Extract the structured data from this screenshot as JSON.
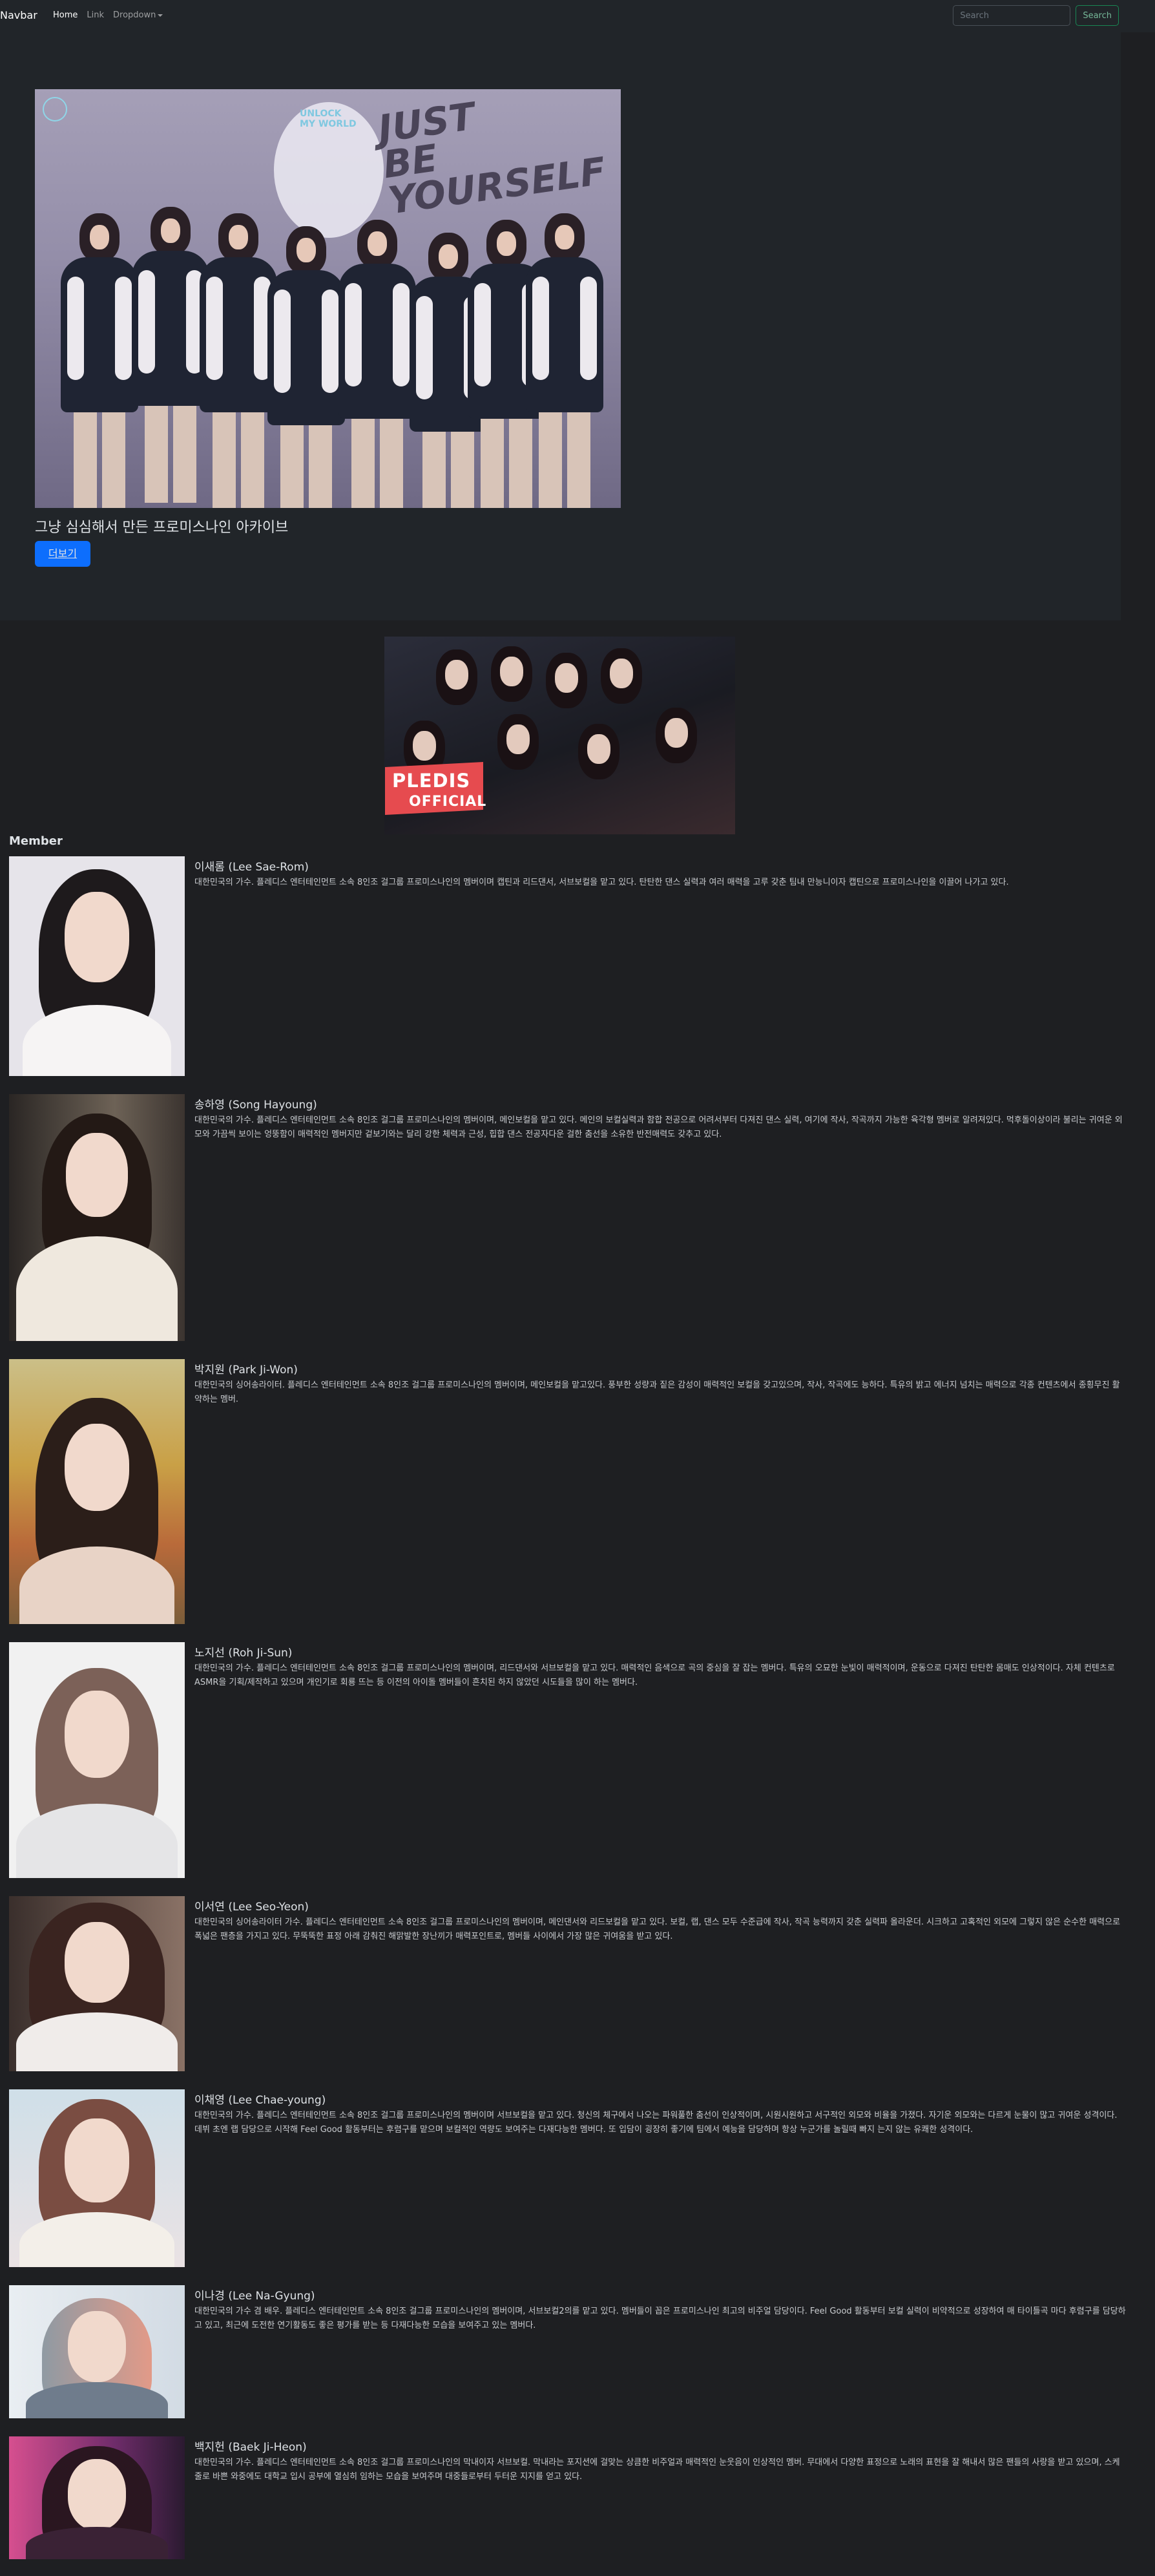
{
  "navbar": {
    "brand": "Navbar",
    "links": [
      "Home",
      "Link",
      "Dropdown"
    ],
    "search_placeholder": "Search",
    "search_button": "Search"
  },
  "hero": {
    "caption": "그냥 심심해서 만든 프로미스나인 아카이브",
    "button": "더보기"
  },
  "video": {
    "badge_title": "PLEDIS",
    "badge_subtitle": "OFFICIAL"
  },
  "members_title": "Member",
  "members": [
    {
      "name": "이새롬 (Lee Sae-Rom)",
      "desc": "대한민국의 가수. 플레디스 엔터테인먼트 소속 8인조 걸그룹 프로미스나인의 멤버이며 캡틴과 리드댄서, 서브보컬을 맡고 있다. 탄탄한 댄스 실력과 여러 매력을 고루 갖춘 팀내 만능니이자 캡틴으로 프로미스나인을 이끌어 나가고 있다."
    },
    {
      "name": "송하영 (Song Hayoung)",
      "desc": "대한민국의 가수. 플레디스 엔터테인먼트 소속 8인조 걸그룹 프로미스나인의 멤버이며, 메인보컬을 맡고 있다. 메인의 보컬실력과 함합 전공으로 어려서부터 다져진 댄스 실력, 여기에 작사, 작곡까지 가능한 육각형 멤버로 알려져있다. 먹후돌이상이라 불리는 귀여운 외모와 가끔씩 보이는 엉뚱함이 매력적인 멤버지만 겉보기와는 달리 강한 체력과 근성, 힙합 댄스 전공자다운 걸한 춤선을 소유한 반전매력도 갖추고 있다."
    },
    {
      "name": "박지원 (Park Ji-Won)",
      "desc": "대한민국의 싱어송라이터. 플레디스 엔터테인먼트 소속 8인조 걸그룹 프로미스나인의 멤버이며, 메인보컬을 맡고있다. 풍부한 성량과 짙은 감성이 매력적인 보컬을 갖고있으며, 작사, 작곡에도 능하다. 특유의 밝고 에너지 넘치는 매력으로 각종 컨텐츠에서 종횡무진 활약하는 멤버."
    },
    {
      "name": "노지선 (Roh Ji-Sun)",
      "desc": "대한민국의 가수. 플레디스 엔터테인먼트 소속 8인조 걸그룹 프로미스나인의 멤버이며, 리드댄서와 서브보컬을 맡고 있다. 매력적인 음색으로 곡의 중심을 잘 잡는 멤버다. 특유의 오묘한 눈빛이 매력적이며, 운동으로 다져진 탄탄한 몸매도 인상적이다. 자체 컨텐츠로 ASMR을 기획/제작하고 있으며 개인기로 회룡 뜨는 등 이전의 아이돌 멤버들이 흔치된 하지 않았던 시도들을 많이 하는 멤버다."
    },
    {
      "name": "이서연 (Lee Seo-Yeon)",
      "desc": "대한민국의 싱어송라이터 가수. 플레디스 엔터테인먼트 소속 8인조 걸그룹 프로미스나인의 멤버이며, 메인댄서와 리드보컬을 맡고 있다. 보컬, 랩, 댄스 모두 수준급에 작사, 작곡 능력까지 갖춘 실력파 올라운더. 시크하고 고혹적인 외모에 그렇지 않은 순수한 매력으로 폭넓은 팬층을 가지고 있다. 무뚝뚝한 표정 아래 감춰진 해맑발한 장난끼가 매력포인트로, 멤버들 사이에서 가장 많은 귀여움을 받고 있다."
    },
    {
      "name": "이채영 (Lee Chae-young)",
      "desc": "대한민국의 가수. 플레디스 엔터테인먼트 소속 8인조 걸그룹 프로미스나인의 멤버이며 서브보컬을 맡고 있다. 청신의 체구에서 나오는 파워풀한 춤선이 인상적이며, 시원시원하고 서구적인 외모와 비율을 가졌다. 자기운 외모와는 다르게 눈물이 많고 귀여운 성격이다. 데뷔 초엔 랩 담당으로 시작해 Feel Good 활동부터는 후렴구를 맡으며 보컬적인 역량도 보여주는 다재다능한 멤버다. 또 입담이 굉장히 좋기에 팀에서 예능을 담당하며 항상 누군가를 놀릴때 빠지 는지 않는 유쾌한 성격이다."
    },
    {
      "name": "이나경 (Lee Na-Gyung)",
      "desc": "대한민국의 가수 겸 배우. 플레디스 엔터테인먼트 소속 8인조 걸그룹 프로미스나인의 멤버이며, 서브보컬2의를 맡고 있다. 멤버들이 꼽은 프로미스나인 최고의 비주얼 담당이다. Feel Good 활동부터 보컬 실력이 비약적으로 성장하여 매 타이틀곡 마다 후렴구를 담당하고 있고, 최근에 도전한 연기활동도 좋은 평가를 받는 등 다재다능한 모습을 보여주고 있는 멤버다."
    },
    {
      "name": "백지헌 (Baek Ji-Heon)",
      "desc": "대한민국의 가수. 플레디스 엔터테인먼트 소속 8인조 걸그룹 프로미스나인의 막내이자 서브보컬. 막내라는 포지션에 걸맞는 상큼한 비주얼과 매력적인 눈웃음이 인상적인 멤버. 무대에서 다양한 표정으로 노래의 표현을 잘 해내서 많은 팬들의 사랑을 받고 있으며, 스케줄로 바쁜 와중에도 대학교 입시 공부에 열심히 임하는 모습을 보여주며 대중들로부터 두터운 지지를 얻고 있다."
    }
  ],
  "colors": {
    "background": "#1e1f22",
    "navbar": "#212529",
    "primary": "#0d6efd",
    "success": "#198754",
    "pledis": "#e64b4f"
  }
}
